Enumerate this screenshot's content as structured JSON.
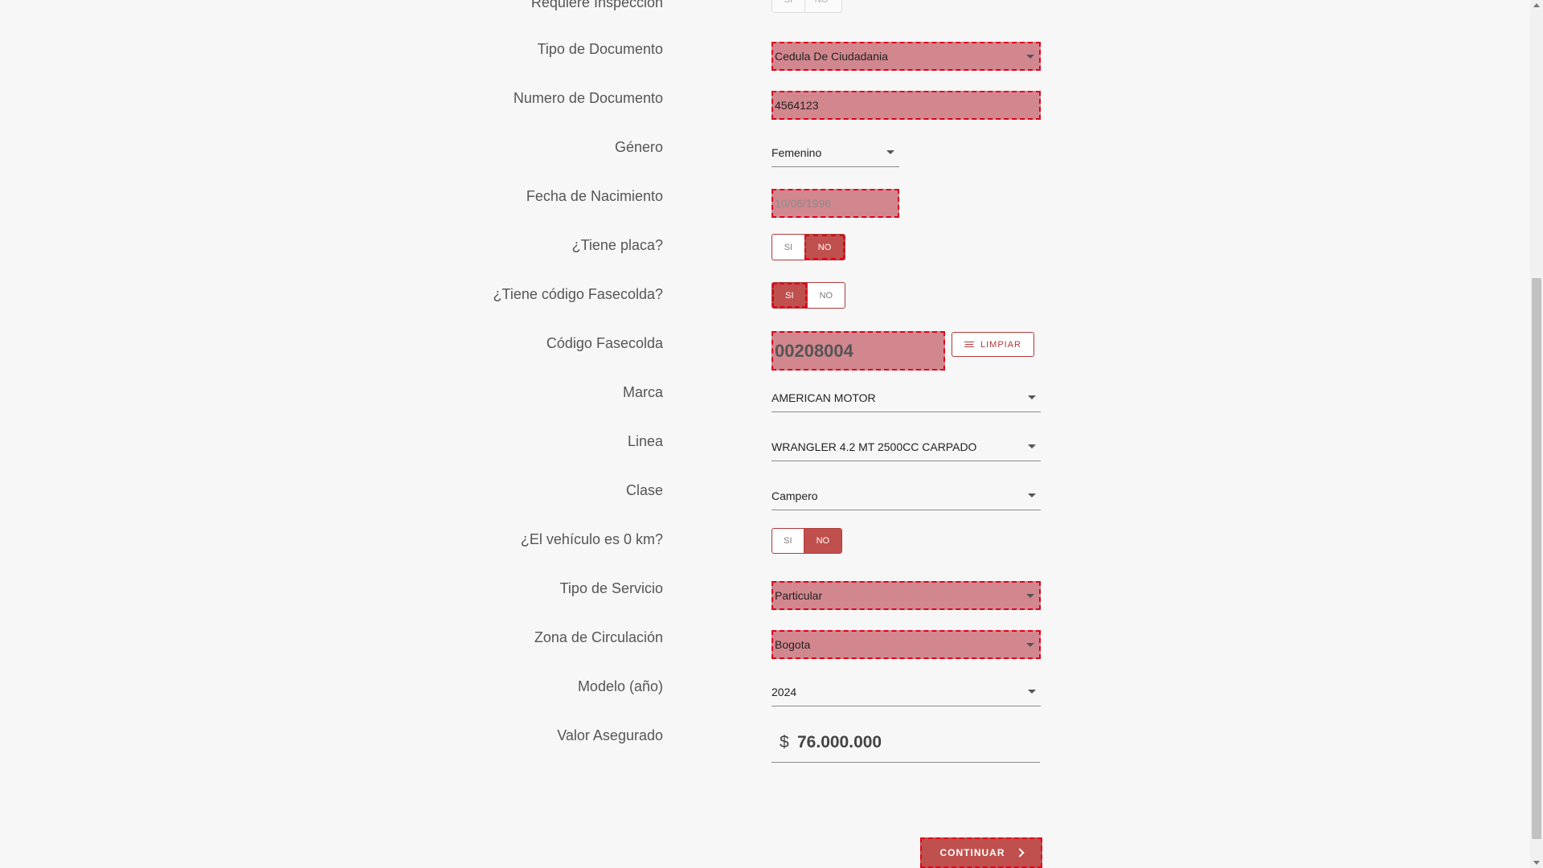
{
  "form": {
    "requiere_inspeccion": {
      "label": "Requiere Inspección",
      "options": [
        "SI",
        "NO"
      ]
    },
    "tipo_documento": {
      "label": "Tipo de Documento",
      "value": "Cedula De Ciudadania"
    },
    "numero_documento": {
      "label": "Numero de Documento",
      "value": "4564123"
    },
    "genero": {
      "label": "Género",
      "value": "Femenino"
    },
    "fecha_nacimiento": {
      "label": "Fecha de Nacimiento",
      "value": "10/06/1996"
    },
    "tiene_placa": {
      "label": "¿Tiene placa?",
      "options": [
        "SI",
        "NO"
      ],
      "selected": "NO"
    },
    "tiene_fasecolda": {
      "label": "¿Tiene código Fasecolda?",
      "options": [
        "SI",
        "NO"
      ],
      "selected": "SI"
    },
    "codigo_fasecolda": {
      "label": "Código Fasecolda",
      "value": "00208004",
      "clear_label": "LIMPIAR"
    },
    "marca": {
      "label": "Marca",
      "value": "AMERICAN MOTOR"
    },
    "linea": {
      "label": "Linea",
      "value": "WRANGLER 4.2 MT 2500CC CARPADO"
    },
    "clase": {
      "label": "Clase",
      "value": "Campero"
    },
    "cero_km": {
      "label": "¿El vehículo es 0 km?",
      "options": [
        "SI",
        "NO"
      ],
      "selected": "NO"
    },
    "tipo_servicio": {
      "label": "Tipo de Servicio",
      "value": "Particular"
    },
    "zona_circulacion": {
      "label": "Zona de Circulación",
      "value": "Bogota"
    },
    "modelo": {
      "label": "Modelo (año)",
      "value": "2024"
    },
    "valor_asegurado": {
      "label": "Valor Asegurado",
      "currency": "$",
      "value": "76.000.000"
    }
  },
  "actions": {
    "continue_label": "CONTINUAR"
  },
  "colors": {
    "accent": "#c0504d",
    "error_fill": "#d2878f",
    "error_border": "#e0001b"
  }
}
